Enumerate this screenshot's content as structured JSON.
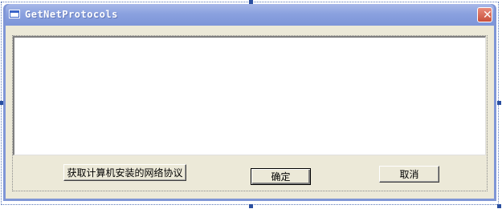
{
  "window": {
    "title": "GetNetProtocols",
    "close_glyph": "✕"
  },
  "buttons": {
    "get_protocols_label": "获取计算机安装的网络协议",
    "ok_label": "确定",
    "cancel_label": "取消"
  },
  "icons": {
    "app_icon": "window-icon",
    "close_icon": "close-icon"
  },
  "colors": {
    "titlebar": "#8aa1df",
    "client_bg": "#ece9d8",
    "close_button": "#d06a58"
  }
}
